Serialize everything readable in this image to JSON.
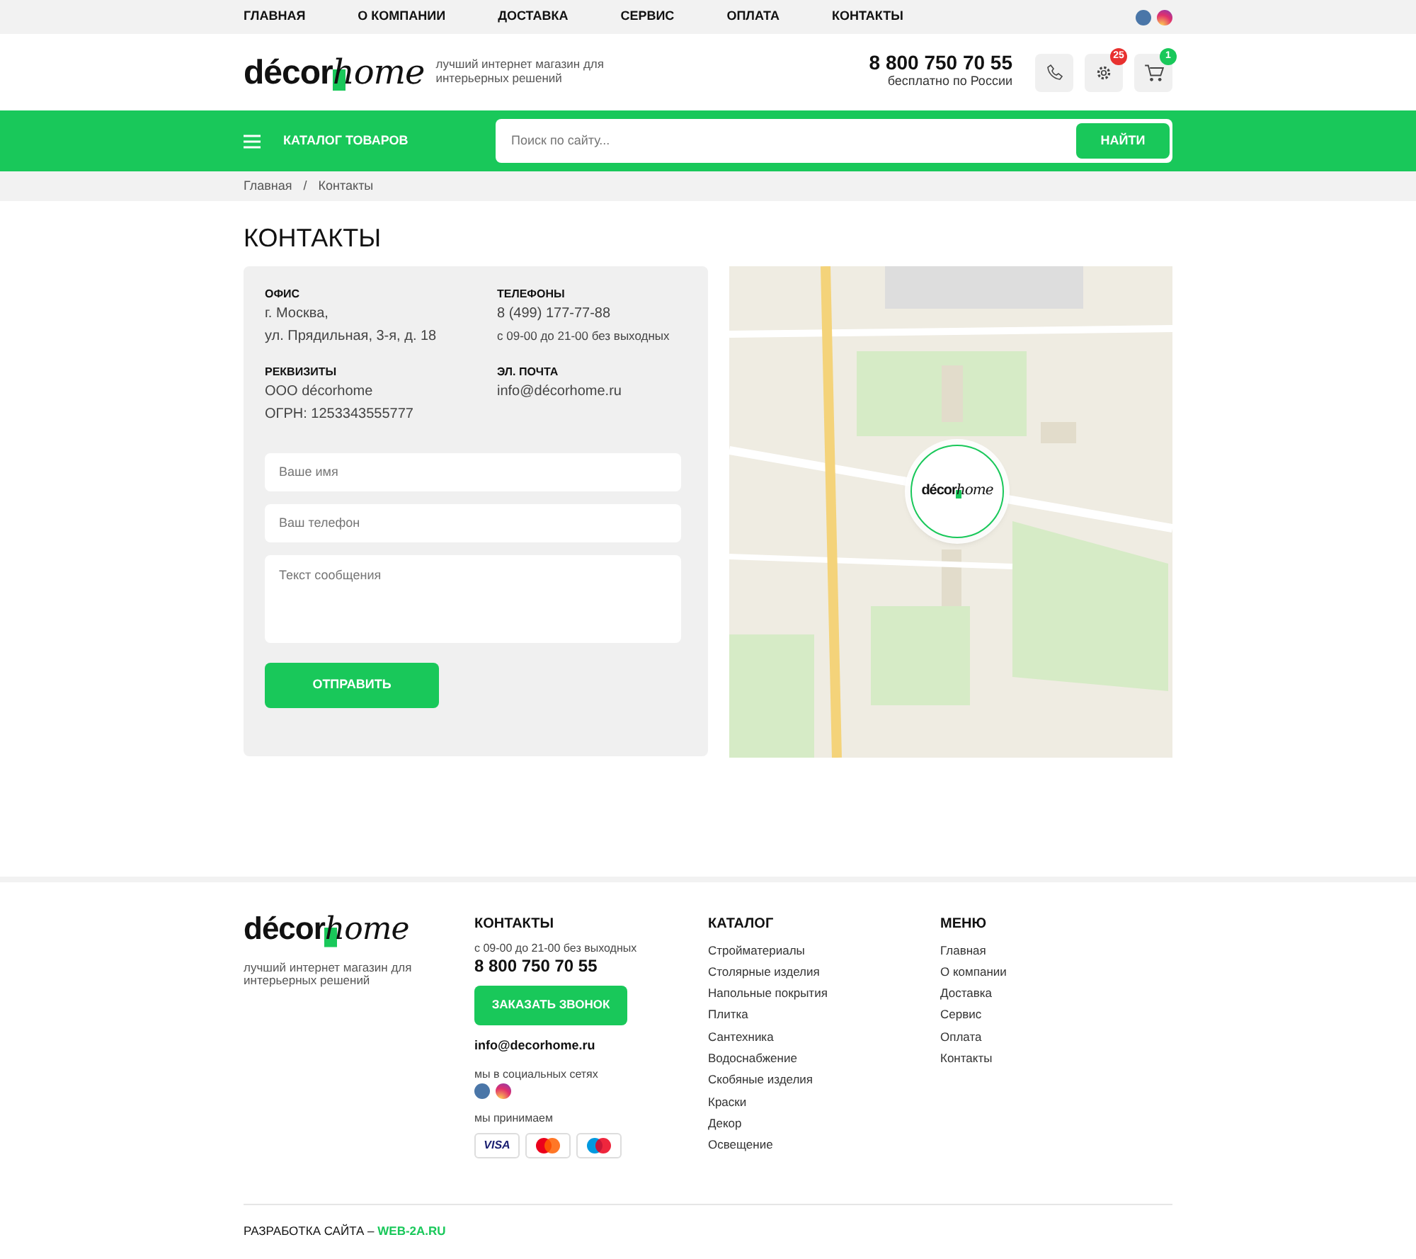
{
  "top_nav": {
    "items": [
      {
        "label": "ГЛАВНАЯ"
      },
      {
        "label": "О КОМПАНИИ"
      },
      {
        "label": "ДОСТАВКА"
      },
      {
        "label": "СЕРВИС"
      },
      {
        "label": "ОПЛАТА"
      },
      {
        "label": "КОНТАКТЫ"
      }
    ],
    "social": [
      {
        "kind": "vk"
      },
      {
        "kind": "instagram"
      }
    ]
  },
  "header": {
    "logo": {
      "part_1": "décor",
      "part_2": "home"
    },
    "tagline": "лучший интернет магазин для интерьерных решений",
    "phone": "8 800 750 70 55",
    "phone_note": "бесплатно по России",
    "buttons": [
      {
        "kind": "phone"
      },
      {
        "kind": "settings",
        "badge": "25",
        "color": "#e8312f"
      },
      {
        "kind": "cart",
        "badge": "1",
        "color": "#19c85a"
      }
    ]
  },
  "catalog_bar": {
    "catalog_label": "КАТАЛОГ ТОВАРОВ",
    "search": {
      "placeholder": "Поиск по сайту..."
    },
    "search_button": "НАЙТИ"
  },
  "breadcrumbs": [
    {
      "label": "Главная"
    },
    {
      "kind": "separator",
      "label": "/"
    },
    {
      "label": "Контакты"
    }
  ],
  "page_title": "КОНТАКТЫ",
  "contacts": [
    {
      "heading": "ОФИС",
      "lines": [
        "г. Москва,",
        "ул. Прядильная, 3-я, д. 18"
      ]
    },
    {
      "heading": "ТЕЛЕФОНЫ",
      "lines": [
        "8 (499) 177-77-88",
        "с 09-00 до 21-00 без выходных"
      ]
    },
    {
      "heading": "РЕКВИЗИТЫ",
      "lines": [
        "ООО décorhome",
        "ОГРН: 1253343555777"
      ]
    },
    {
      "heading": "ЭЛ. ПОЧТА",
      "lines": [
        "info@décorhome.ru"
      ]
    }
  ],
  "form": {
    "fields": [
      {
        "kind": "input",
        "placeholder": "Ваше имя"
      },
      {
        "kind": "input",
        "placeholder": "Ваш телефон"
      },
      {
        "kind": "textarea",
        "placeholder": "Текст сообщения"
      }
    ],
    "submit": "ОТПРАВИТЬ"
  },
  "map": {
    "kind": "picture",
    "marker": {
      "part_1": "décor",
      "part_2": "home"
    }
  },
  "footer": {
    "logo": {
      "part_1": "décor",
      "part_2": "home"
    },
    "tagline": "лучший интернет магазин для интерьерных решений",
    "contacts": {
      "heading": "КОНТАКТЫ",
      "hours": "с 09-00 до 21-00 без выходных",
      "phone": "8 800 750 70 55",
      "call_button": "ЗАКАЗАТЬ ЗВОНОК",
      "email": "info@decorhome.ru",
      "social_label": "мы в социальных сетях",
      "social": [
        {
          "kind": "vk"
        },
        {
          "kind": "instagram"
        }
      ],
      "payments_label": "мы принимаем",
      "payments": [
        {
          "kind": "visa",
          "label": "VISA"
        },
        {
          "kind": "mastercard"
        },
        {
          "kind": "maestro"
        }
      ]
    },
    "catalog": {
      "heading": "КАТАЛОГ",
      "items": [
        "Стройматериалы",
        "Столярные изделия",
        "Напольные покрытия",
        "Плитка",
        "Сантехника",
        "Водоснабжение",
        "Скобяные изделия",
        "Краски",
        "Декор",
        "Освещение"
      ]
    },
    "menu": {
      "heading": "МЕНЮ",
      "items": [
        "Главная",
        "О компании",
        "Доставка",
        "Сервис",
        "Оплата",
        "Контакты"
      ]
    },
    "credits": {
      "label": "РАЗРАБОТКА САЙТА –",
      "link": "WEB-2A.RU"
    }
  }
}
